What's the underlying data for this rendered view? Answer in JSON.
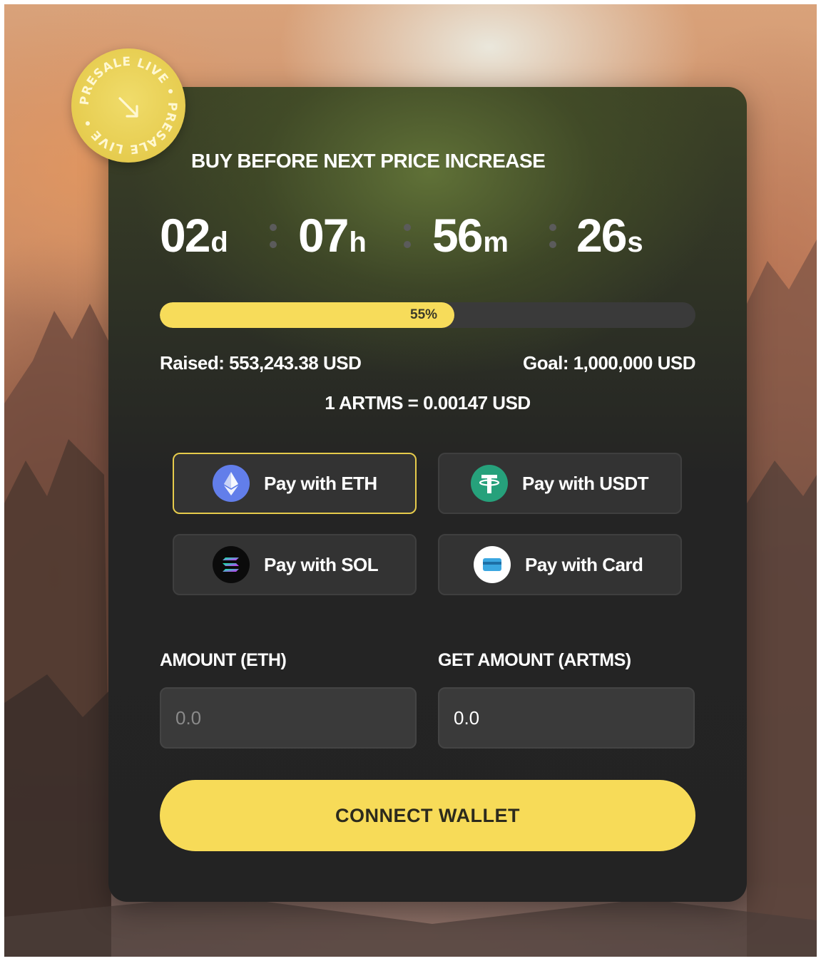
{
  "badge": {
    "text": "PRESALE LIVE • PRESALE LIVE •",
    "icon": "arrow-down-right-icon"
  },
  "headline": "BUY BEFORE NEXT PRICE INCREASE",
  "countdown": {
    "days": "02",
    "days_unit": "d",
    "hours": "07",
    "hours_unit": "h",
    "minutes": "56",
    "minutes_unit": "m",
    "seconds": "26",
    "seconds_unit": "s"
  },
  "progress": {
    "percent": 55,
    "label": "55%"
  },
  "raised": "Raised: 553,243.38 USD",
  "goal": "Goal: 1,000,000 USD",
  "rate": "1 ARTMS = 0.00147 USD",
  "payment_options": [
    {
      "label": "Pay with ETH",
      "icon": "ethereum-icon",
      "active": true
    },
    {
      "label": "Pay with USDT",
      "icon": "tether-icon",
      "active": false
    },
    {
      "label": "Pay with SOL",
      "icon": "solana-icon",
      "active": false
    },
    {
      "label": "Pay with Card",
      "icon": "credit-card-icon",
      "active": false
    }
  ],
  "amount": {
    "label": "AMOUNT (ETH)",
    "placeholder": "0.0",
    "value": ""
  },
  "get_amount": {
    "label": "GET AMOUNT (ARTMS)",
    "placeholder": "0.0",
    "value": "0.0"
  },
  "connect_label": "CONNECT WALLET",
  "colors": {
    "accent": "#f7db58",
    "card": "#232323",
    "eth": "#627eea",
    "usdt": "#26a17b"
  }
}
